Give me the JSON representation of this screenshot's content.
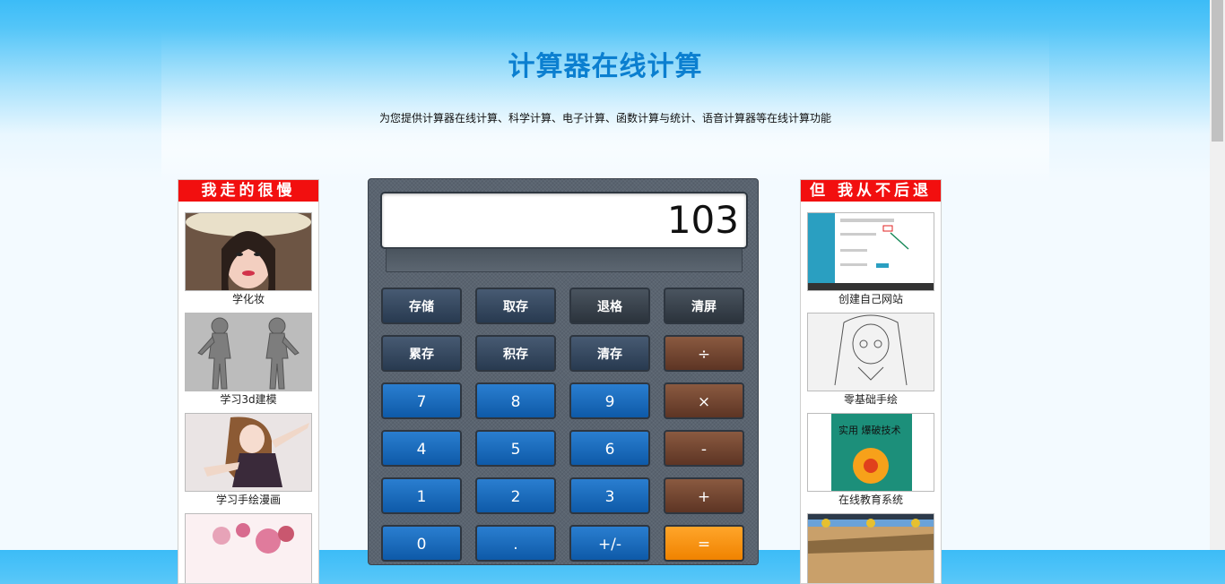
{
  "header": {
    "title": "计算器在线计算",
    "subtitle": "为您提供计算器在线计算、科学计算、电子计算、函数计算与统计、语音计算器等在线计算功能"
  },
  "left_panel": {
    "banner": "我走的很慢",
    "items": [
      {
        "caption": "学化妆"
      },
      {
        "caption": "学习3d建模"
      },
      {
        "caption": "学习手绘漫画"
      },
      {
        "caption": ""
      }
    ]
  },
  "right_panel": {
    "banner": "但 我从不后退",
    "items": [
      {
        "caption": "创建自己网站"
      },
      {
        "caption": "零基础手绘"
      },
      {
        "caption": "在线教育系统"
      },
      {
        "caption": ""
      }
    ],
    "book_text": "实用 爆破技术"
  },
  "calculator": {
    "display": "103",
    "buttons": {
      "store": "存储",
      "recall": "取存",
      "backspace": "退格",
      "clear": "清屏",
      "mem_add": "累存",
      "mem_mul": "积存",
      "mem_clear": "清存",
      "divide": "÷",
      "seven": "7",
      "eight": "8",
      "nine": "9",
      "multiply": "×",
      "four": "4",
      "five": "5",
      "six": "6",
      "minus": "-",
      "one": "1",
      "two": "2",
      "three": "3",
      "plus": "+",
      "zero": "0",
      "dot": ".",
      "negate": "+/-",
      "equals": "="
    }
  },
  "colors": {
    "title": "#0b7fd0",
    "banner": "#f20f0f",
    "num_button": "#1a6cc0",
    "op_button": "#6e4330",
    "equals_button": "#f58a00"
  }
}
